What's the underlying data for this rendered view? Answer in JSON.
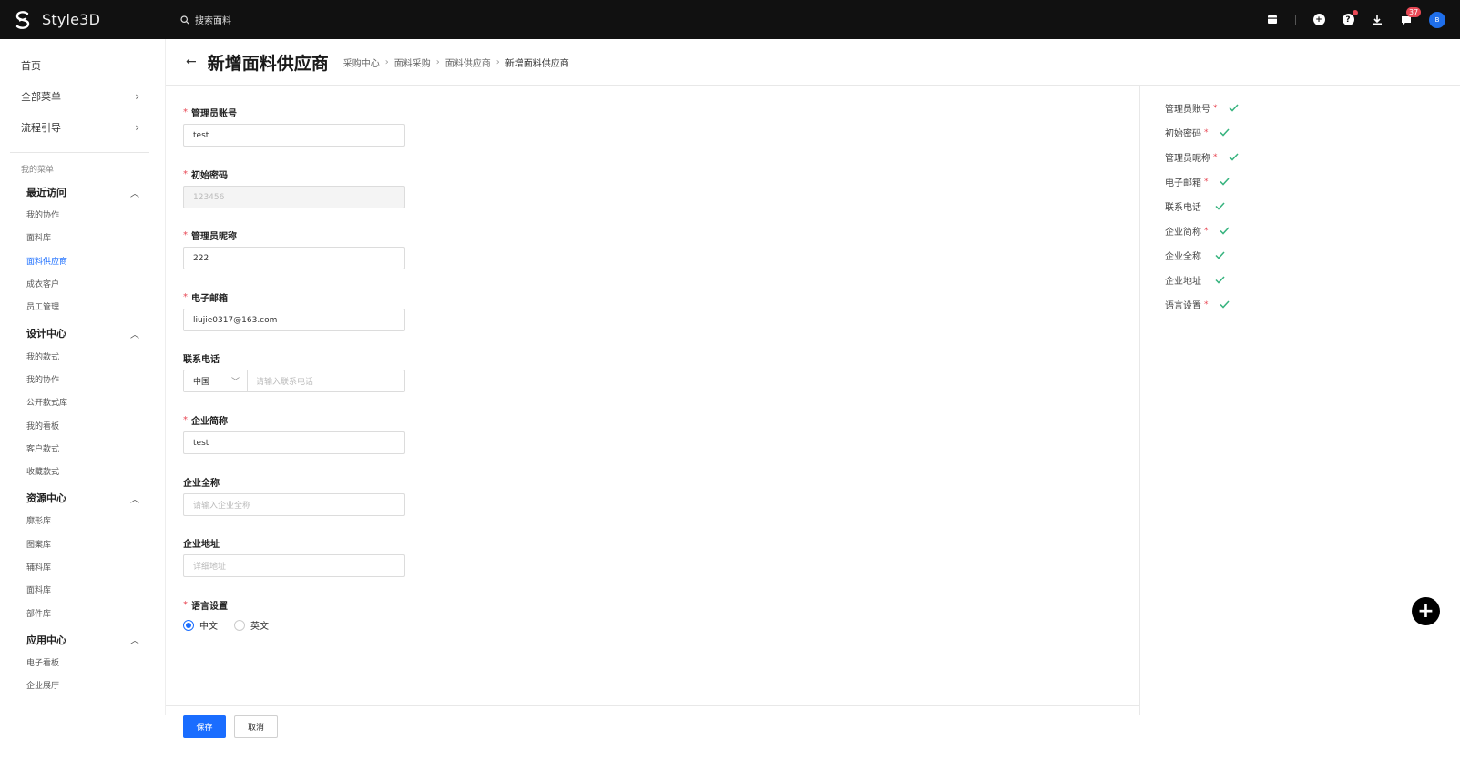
{
  "app": {
    "brand": "Style3D"
  },
  "search": {
    "placeholder": "搜索面料"
  },
  "topbar": {
    "notification_count": "37",
    "avatar_text": "B"
  },
  "sidebar": {
    "top_items": [
      {
        "label": "首页"
      },
      {
        "label": "全部菜单"
      },
      {
        "label": "流程引导"
      }
    ],
    "my_menu_label": "我的菜单",
    "groups": [
      {
        "label": "最近访问",
        "items": [
          "我的协作",
          "面料库",
          "面料供应商",
          "成衣客户",
          "员工管理"
        ]
      },
      {
        "label": "设计中心",
        "items": [
          "我的款式",
          "我的协作",
          "公开款式库",
          "我的看板",
          "客户款式",
          "收藏款式"
        ]
      },
      {
        "label": "资源中心",
        "items": [
          "廓形库",
          "图案库",
          "辅料库",
          "面料库",
          "部件库"
        ]
      },
      {
        "label": "应用中心",
        "items": [
          "电子看板",
          "企业展厅"
        ]
      }
    ],
    "active_item": "面料供应商"
  },
  "page": {
    "back_icon": "arrow-left",
    "title": "新增面料供应商",
    "breadcrumb": [
      "采购中心",
      "面料采购",
      "面料供应商",
      "新增面料供应商"
    ]
  },
  "form": {
    "admin_account": {
      "label": "管理员账号",
      "value": "test"
    },
    "initial_password": {
      "label": "初始密码",
      "value": "123456"
    },
    "admin_nickname": {
      "label": "管理员昵称",
      "value": "222"
    },
    "email": {
      "label": "电子邮箱",
      "value": "liujie0317@163.com"
    },
    "phone": {
      "label": "联系电话",
      "country": "中国",
      "placeholder": "请输入联系电话"
    },
    "short_name": {
      "label": "企业简称",
      "value": "test"
    },
    "full_name": {
      "label": "企业全称",
      "placeholder": "请输入企业全称"
    },
    "address": {
      "label": "企业地址",
      "placeholder": "详细地址"
    },
    "language": {
      "label": "语言设置",
      "options": [
        "中文",
        "英文"
      ],
      "selected": "中文"
    }
  },
  "buttons": {
    "save": "保存",
    "cancel": "取消"
  },
  "checklist": [
    {
      "label": "管理员账号",
      "required": "*"
    },
    {
      "label": "初始密码",
      "required": "*"
    },
    {
      "label": "管理员昵称",
      "required": "*"
    },
    {
      "label": "电子邮箱",
      "required": "*"
    },
    {
      "label": "联系电话",
      "required": ""
    },
    {
      "label": "企业简称",
      "required": "*"
    },
    {
      "label": "企业全称",
      "required": ""
    },
    {
      "label": "企业地址",
      "required": ""
    },
    {
      "label": "语言设置",
      "required": "*"
    }
  ],
  "colors": {
    "accent": "#1a6dff",
    "check": "#36b37e",
    "required": "#e84855",
    "topbar": "#111111"
  }
}
